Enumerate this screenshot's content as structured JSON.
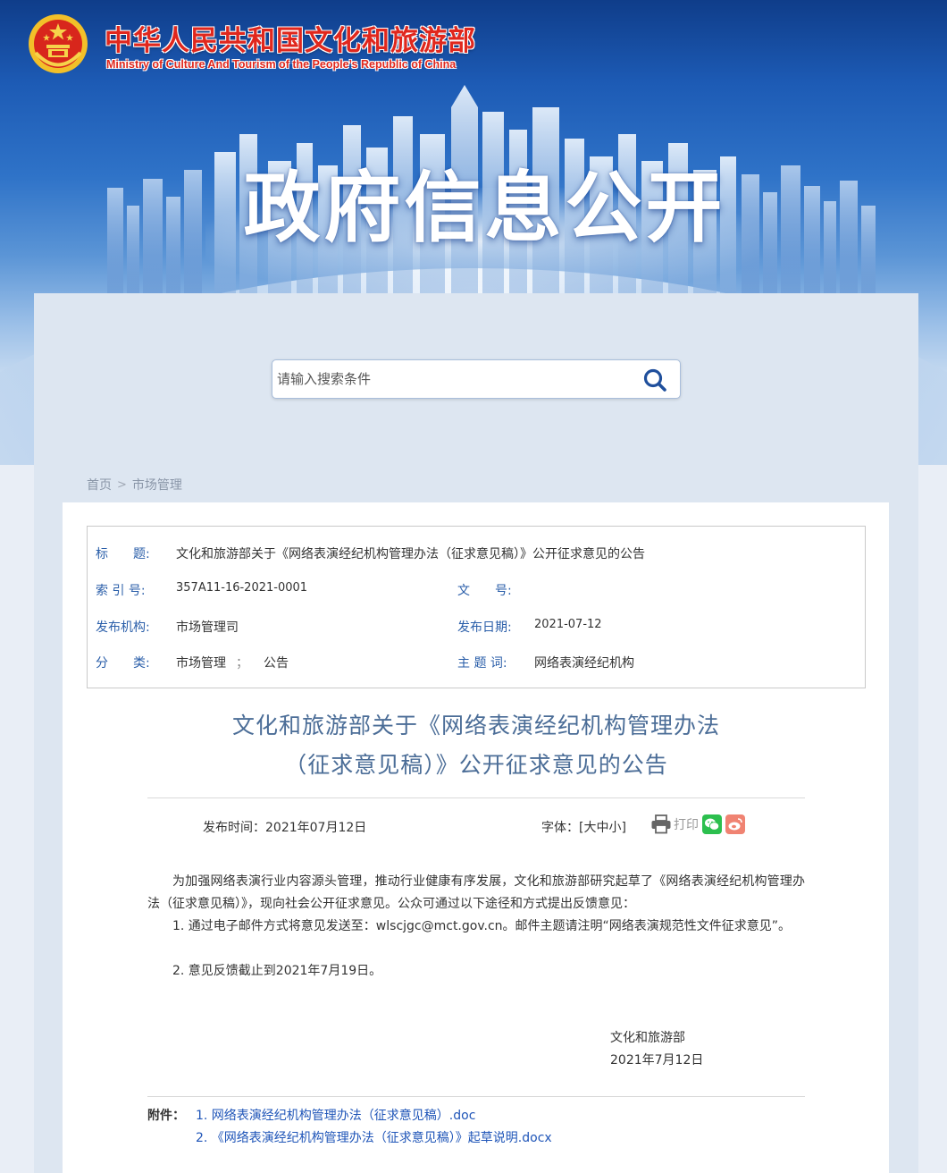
{
  "header": {
    "site_title": "中华人民共和国文化和旅游部",
    "site_subtitle": "Ministry of Culture And Tourism of the People’s Republic of China",
    "hero_title": "政府信息公开"
  },
  "search": {
    "placeholder": "请输入搜索条件"
  },
  "breadcrumb": {
    "home": "首页",
    "separator": ">",
    "current": "市场管理"
  },
  "meta": {
    "title_label": "标　　题:",
    "title_value": "文化和旅游部关于《网络表演经纪机构管理办法（征求意见稿）》公开征求意见的公告",
    "index_label": "索 引 号:",
    "index_value": "357A11-16-2021-0001",
    "doc_no_label": "文　　号:",
    "doc_no_value": "",
    "publisher_label": "发布机构:",
    "publisher_value": "市场管理司",
    "date_label": "发布日期:",
    "date_value": "2021-07-12",
    "category_label": "分　　类:",
    "category_value": "市场管理",
    "category_sep": "；",
    "category_value2": "公告",
    "subject_label": "主 题 词:",
    "subject_value": "网络表演经纪机构"
  },
  "article": {
    "title_line1": "文化和旅游部关于《网络表演经纪机构管理办法",
    "title_line2": "（征求意见稿）》公开征求意见的公告",
    "pub_time": "发布时间：2021年07月12日",
    "font_label": "字体：",
    "font_open": "[",
    "font_large": "大",
    "font_medium": "中",
    "font_small": "小",
    "font_close": "]",
    "print_label": "打印",
    "para1": "为加强网络表演行业内容源头管理，推动行业健康有序发展，文化和旅游部研究起草了《网络表演经纪机构管理办法（征求意见稿）》，现向社会公开征求意见。公众可通过以下途径和方式提出反馈意见：",
    "item1": "1. 通过电子邮件方式将意见发送至：wlscjgc@mct.gov.cn。邮件主题请注明“网络表演规范性文件征求意见”。",
    "item2": "2. 意见反馈截止到2021年7月19日。",
    "signature_org": "文化和旅游部",
    "signature_date": "2021年7月12日"
  },
  "attachments": {
    "label": "附件：",
    "items": [
      "1. 网络表演经纪机构管理办法（征求意见稿）.doc",
      "2. 《网络表演经纪机构管理办法（征求意见稿）》起草说明.docx"
    ]
  },
  "colors": {
    "brand_red": "#e0271d",
    "link_blue": "#1f55b8",
    "label_blue": "#2a5ea9",
    "title_blue": "#4b6d97",
    "wechat_green": "#2cbf4e",
    "weibo_pink": "#f08372"
  },
  "icons": {
    "emblem": "national-emblem-icon",
    "search": "search-icon",
    "print": "printer-icon",
    "wechat": "wechat-icon",
    "weibo": "weibo-icon"
  }
}
